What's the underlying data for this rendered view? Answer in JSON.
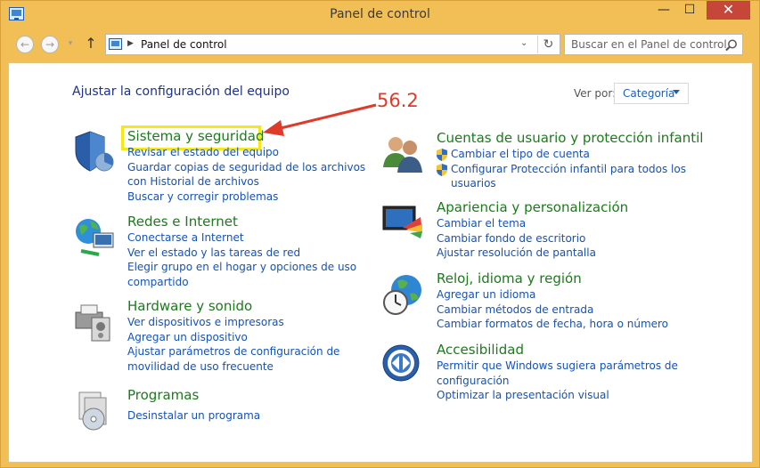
{
  "window": {
    "title": "Panel de control",
    "controls": {
      "minimize": "—",
      "maximize": "☐",
      "close": "✕"
    }
  },
  "nav": {
    "back": "←",
    "forward": "→",
    "recent": "▾",
    "up": "↑"
  },
  "address": {
    "separator": "▶",
    "path": "Panel de control",
    "dropdown": "⌄",
    "refresh": "↻"
  },
  "search": {
    "placeholder": "Buscar en el Panel de control"
  },
  "header": {
    "title": "Ajustar la configuración del equipo",
    "view_by_label": "Ver por:",
    "view_by_value": "Categoría"
  },
  "annotation": {
    "label": "56.2",
    "color": "#e03a2a",
    "highlight_color": "#f4e81a"
  },
  "categories": {
    "sistema": {
      "icon": "shield-icon",
      "title": "Sistema y seguridad",
      "links": [
        "Revisar el estado del equipo",
        "Guardar copias de seguridad de los archivos con Historial de archivos",
        "Buscar y corregir problemas"
      ]
    },
    "redes": {
      "icon": "network-globe-icon",
      "title": "Redes e Internet",
      "links": [
        "Conectarse a Internet",
        "Ver el estado y las tareas de red",
        "Elegir grupo en el hogar y opciones de uso compartido"
      ]
    },
    "hardware": {
      "icon": "printer-speaker-icon",
      "title": "Hardware y sonido",
      "links": [
        "Ver dispositivos e impresoras",
        "Agregar un dispositivo",
        "Ajustar parámetros de configuración de movilidad de uso frecuente"
      ]
    },
    "programas": {
      "icon": "programs-disc-icon",
      "title": "Programas",
      "links": [
        "Desinstalar un programa"
      ]
    },
    "cuentas": {
      "icon": "users-icon",
      "title": "Cuentas de usuario y protección infantil",
      "links": [
        "Cambiar el tipo de cuenta",
        "Configurar Protección infantil para todos los usuarios"
      ]
    },
    "apariencia": {
      "icon": "display-palette-icon",
      "title": "Apariencia y personalización",
      "links": [
        "Cambiar el tema",
        "Cambiar fondo de escritorio",
        "Ajustar resolución de pantalla"
      ]
    },
    "reloj": {
      "icon": "clock-globe-icon",
      "title": "Reloj, idioma y región",
      "links": [
        "Agregar un idioma",
        "Cambiar métodos de entrada",
        "Cambiar formatos de fecha, hora o número"
      ]
    },
    "accesibilidad": {
      "icon": "accessibility-icon",
      "title": "Accesibilidad",
      "links": [
        "Permitir que Windows sugiera parámetros de configuración",
        "Optimizar la presentación visual"
      ]
    }
  }
}
